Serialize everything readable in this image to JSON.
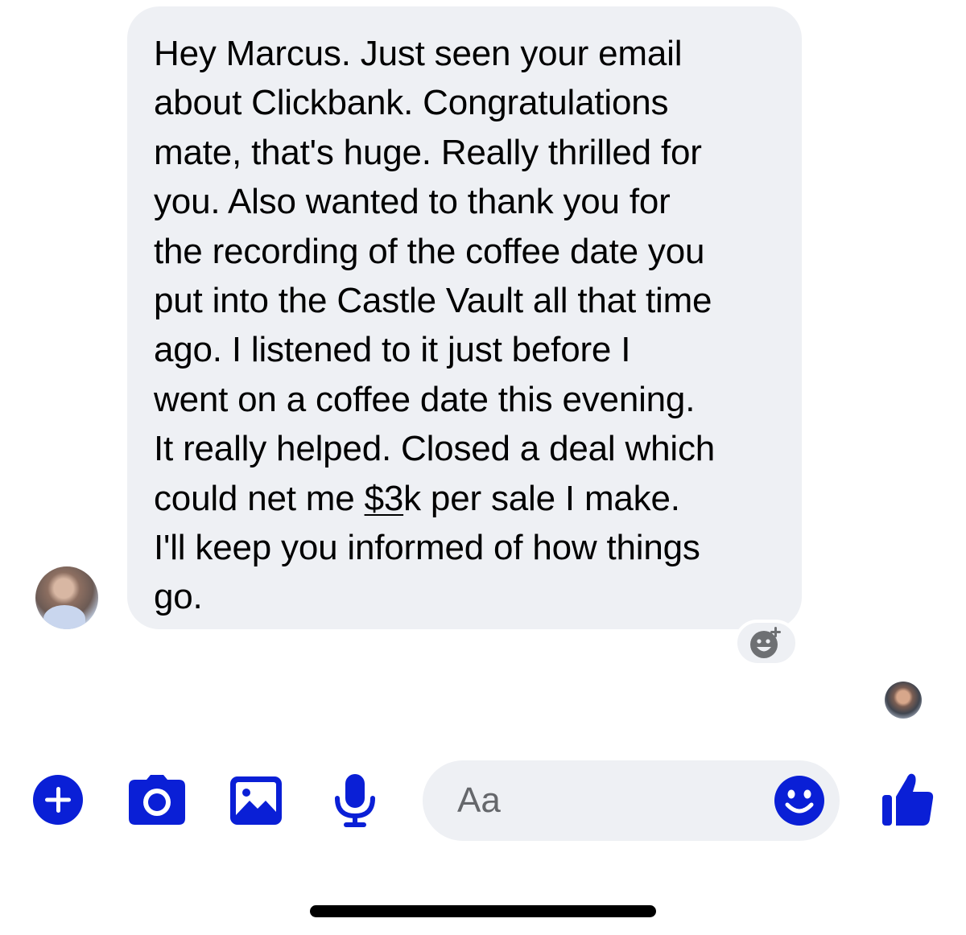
{
  "conversation": {
    "message": {
      "lines": [
        "Hey Marcus.  Just seen your email",
        "about Clickbank.  Congratulations",
        "mate, that's huge.  Really thrilled for",
        "you.  Also wanted to thank you for",
        "the recording of the coffee date you",
        "put into the Castle Vault all that time",
        "ago.  I listened to it just before I",
        "went on a coffee date this evening.",
        "It really helped.  Closed a deal which"
      ],
      "line10_before": "could net me ",
      "line10_link": "$3",
      "line10_after": "k per sale I make.",
      "line11": "I'll keep you informed of how things",
      "line12": "go."
    },
    "react_icon": "add-reaction-icon",
    "sender_avatar_icon": "user-avatar",
    "seen_avatar_icon": "read-receipt-avatar"
  },
  "composer": {
    "placeholder": "Aa",
    "icons": [
      "plus-circle-icon",
      "camera-icon",
      "image-icon",
      "microphone-icon",
      "emoji-icon",
      "thumbs-up-icon"
    ],
    "accent_color": "#0a1fd6"
  }
}
